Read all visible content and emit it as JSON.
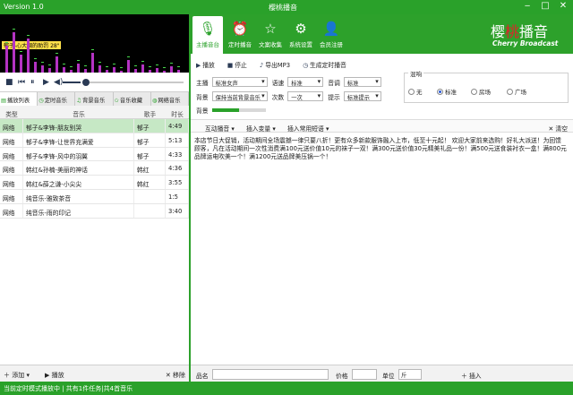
{
  "window": {
    "version": "Version 1.0",
    "title": "樱桃播音"
  },
  "player": {
    "now_playing": "郁子-心大调的助罚 28\""
  },
  "left_tabs": [
    {
      "label": "播放列表",
      "icon": "list-icon"
    },
    {
      "label": "定时音乐",
      "icon": "clock-icon"
    },
    {
      "label": "背景音乐",
      "icon": "music-icon"
    },
    {
      "label": "音乐收藏",
      "icon": "star-icon"
    },
    {
      "label": "网络音乐",
      "icon": "globe-icon"
    }
  ],
  "playlist": {
    "headers": [
      "类型",
      "音乐",
      "歌手",
      "时长"
    ],
    "rows": [
      [
        "网络",
        "郁子&李锋-朋友别哭",
        "郁子",
        "4:49"
      ],
      [
        "网络",
        "郁子&李锋-让世界充满爱",
        "郁子",
        "5:13"
      ],
      [
        "网络",
        "郁子&李锋-风中的羽翼",
        "郁子",
        "4:33"
      ],
      [
        "网络",
        "韩红&孙楠-美丽的神话",
        "韩红",
        "4:36"
      ],
      [
        "网络",
        "韩红&薛之谦-小尖尖",
        "韩红",
        "3:55"
      ],
      [
        "网络",
        "纯音乐-雅致茶音",
        "",
        "1:5"
      ],
      [
        "网络",
        "纯音乐-雨的印记",
        "",
        "3:40"
      ]
    ]
  },
  "left_bottom": {
    "add": "添加",
    "play": "播放",
    "remove": "移除"
  },
  "status": "当前定时模式播放中 | 共有1件任务|共4首音乐",
  "right_tabs": [
    {
      "label": "主播音台",
      "icon": "microphone-icon"
    },
    {
      "label": "定时播音",
      "icon": "alarm-icon"
    },
    {
      "label": "文案收集",
      "icon": "star-icon"
    },
    {
      "label": "系统设置",
      "icon": "settings-icon"
    },
    {
      "label": "会员注册",
      "icon": "user-icon"
    }
  ],
  "brand": {
    "cn_a": "樱",
    "cn_b": "桃",
    "cn_c": "播音",
    "en": "Cherry Broadcast"
  },
  "toolbar": {
    "play": "播放",
    "stop": "停止",
    "export": "导出MP3",
    "generate": "生成定时播音"
  },
  "form": {
    "anchor_label": "主播",
    "anchor_value": "标准女声",
    "speed_label": "语速",
    "speed_value": "标准",
    "tone_label": "音调",
    "tone_value": "标准",
    "bg_label": "背景",
    "bg_value": "保持当前背景音乐",
    "count_label": "次数",
    "count_value": "一次",
    "hint_label": "提示",
    "hint_value": "标准提示",
    "volume_label": "背景",
    "volume_level": 0.5
  },
  "effects": {
    "title": "混响",
    "options": [
      "无",
      "标准",
      "房场",
      "广场"
    ],
    "selected": 1
  },
  "insert_bar": {
    "interact": "互动播音",
    "variable": "插入变量",
    "phrase": "插入常用短语",
    "clear": "清空"
  },
  "content": "本店节日大促销，活动期间全场震撼一律只要八折！更有众多新款服饰融入上市，低至十元起！ 欢迎大家前来选购！好礼大派送！为回馈顾客，凡在活动期间一次性消费满100元送价值10元的袜子一双！满300元送价值30元精美礼品一份！满500元送食装衬衣一盒！满800元品牌运电吹美一个！满1200元送品牌美压锅一个！",
  "right_bottom": {
    "name_label": "品名",
    "price_label": "价格",
    "unit_label": "单位",
    "unit_value": "斤",
    "insert": "插入"
  }
}
